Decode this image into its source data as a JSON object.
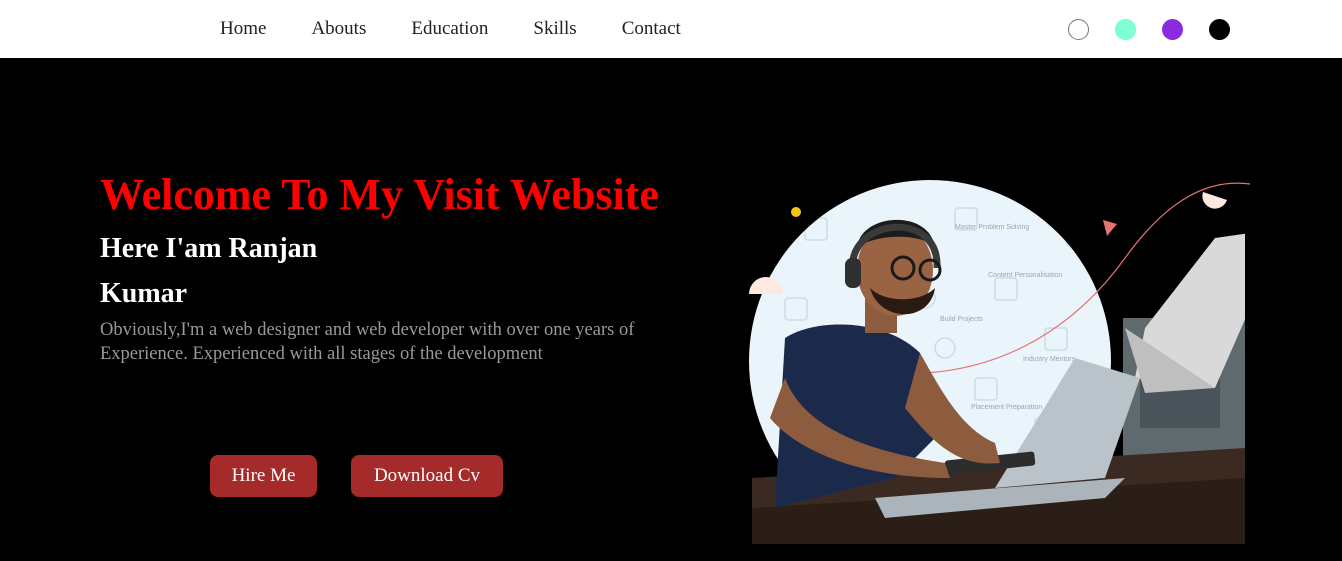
{
  "nav": {
    "links": [
      "Home",
      "Abouts",
      "Education",
      "Skills",
      "Contact"
    ],
    "theme_colors": [
      "#ffffff",
      "#7fffd4",
      "#8a2be2",
      "#000000"
    ]
  },
  "hero": {
    "title": "Welcome To My Visit Website",
    "name": "Here I'am Ranjan Kumar",
    "description": "Obviously,I'm a web designer and web developer with over one years of Experience. Experienced with all stages of the development",
    "hire_label": "Hire Me",
    "cv_label": "Download Cv"
  },
  "illustration": {
    "labels": [
      "Master Problem Solving",
      "Content Personalisation",
      "Build Projects",
      "Industry Mentors",
      "Placement Preparation"
    ]
  },
  "colors": {
    "title": "#ff0000",
    "button": "#a52a2a",
    "background": "#000000"
  }
}
